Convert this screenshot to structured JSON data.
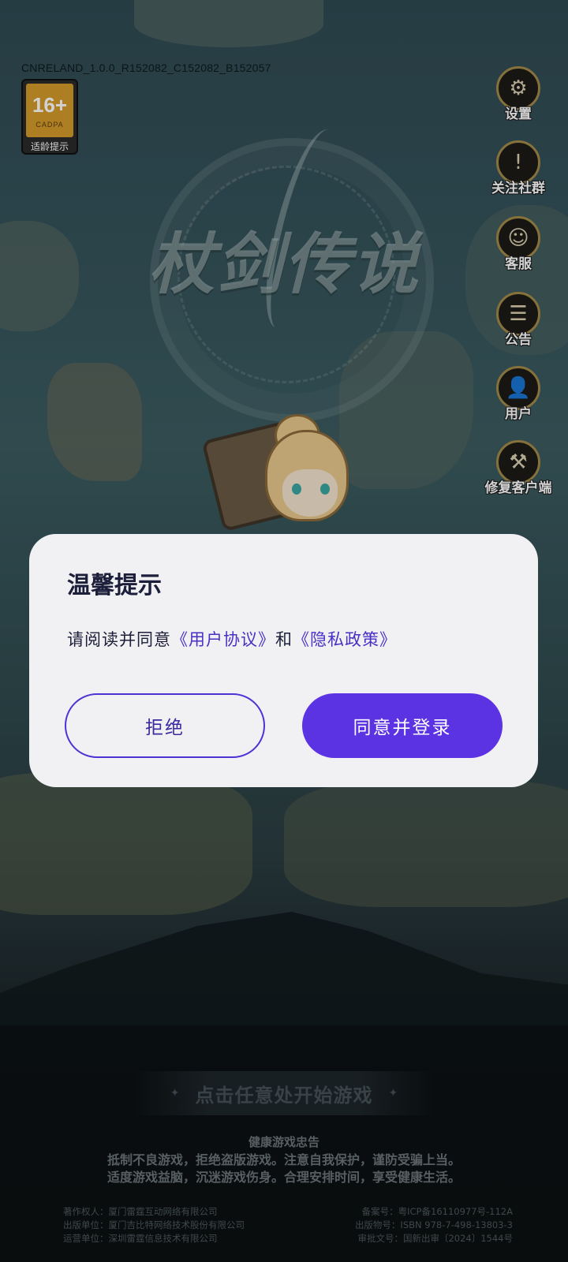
{
  "version_text": "CNRELAND_1.0.0_R152082_C152082_B152057",
  "game_title": "杖剑传说",
  "age_rating": {
    "number": "16+",
    "org": "CADPA",
    "label": "适龄提示"
  },
  "side_menu": [
    {
      "label": "设置",
      "icon": "gear-icon",
      "glyph": "⚙"
    },
    {
      "label": "关注社群",
      "icon": "community-icon",
      "glyph": "!"
    },
    {
      "label": "客服",
      "icon": "headset-icon",
      "glyph": "☺"
    },
    {
      "label": "公告",
      "icon": "notice-board-icon",
      "glyph": "☰"
    },
    {
      "label": "用户",
      "icon": "user-icon",
      "glyph": "👤"
    },
    {
      "label": "修复客户端",
      "icon": "repair-tools-icon",
      "glyph": "⚒"
    }
  ],
  "dialog": {
    "title": "温馨提示",
    "message_prefix": "请阅读并同意",
    "user_agreement": "《用户协议》",
    "conjunction": "和",
    "privacy_policy": "《隐私政策》",
    "reject_label": "拒绝",
    "accept_label": "同意并登录"
  },
  "start_prompt": "点击任意处开始游戏",
  "health_advisory": {
    "title": "健康游戏忠告",
    "line1": "抵制不良游戏，拒绝盗版游戏。注意自我保护，谨防受骗上当。",
    "line2": "适度游戏益脑，沉迷游戏伤身。合理安排时间，享受健康生活。"
  },
  "credits": {
    "copyright_owner": "著作权人：厦门雷霆互动网络有限公司",
    "record_number": "备案号：粤ICP备16110977号-112A",
    "publisher": "出版单位：厦门吉比特网络技术股份有限公司",
    "publication_number": "出版物号：ISBN 978-7-498-13803-3",
    "operator": "运营单位：深圳雷霆信息技术有限公司",
    "approval_number": "审批文号：国新出审〔2024〕1544号"
  },
  "colors": {
    "accent": "#5c33e3",
    "link": "#4a2fc4",
    "dialog_bg": "#f1f1f3",
    "title_text": "#1c1e3a"
  }
}
